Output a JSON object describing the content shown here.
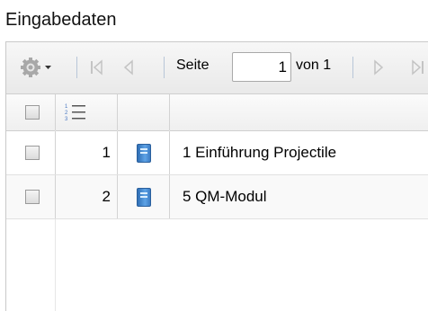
{
  "panel": {
    "title": "Eingabedaten"
  },
  "toolbar": {
    "settings_icon": "gear-icon",
    "first_icon": "first-page-icon",
    "prev_icon": "prev-page-icon",
    "next_icon": "next-page-icon",
    "last_icon": "last-page-icon",
    "page_label": "Seite",
    "page_value": "1",
    "of_label": "von 1"
  },
  "grid": {
    "header_icon": "numbered-list-icon",
    "rows": [
      {
        "number": "1",
        "icon": "book-icon",
        "title": "1 Einführung Projectile"
      },
      {
        "number": "2",
        "icon": "book-icon",
        "title": "5 QM-Modul"
      }
    ]
  }
}
